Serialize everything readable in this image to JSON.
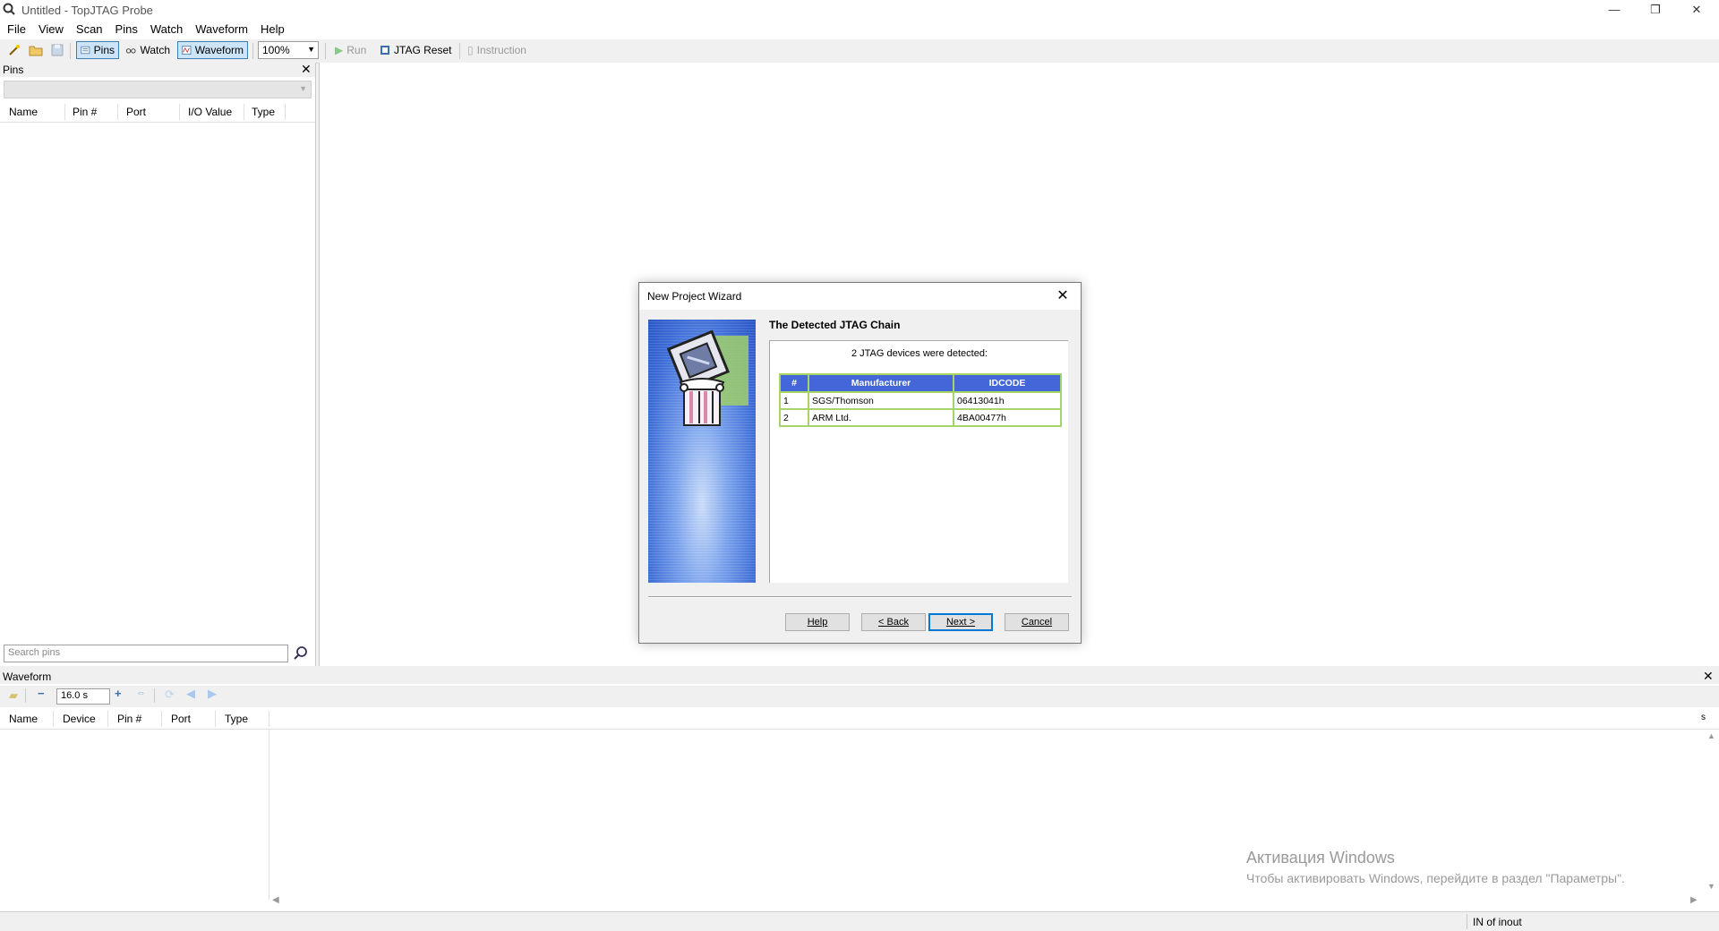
{
  "window": {
    "title": "Untitled - TopJTAG Probe",
    "minimize": "—",
    "maximize": "❐",
    "close": "✕"
  },
  "menu": [
    "File",
    "View",
    "Scan",
    "Pins",
    "Watch",
    "Waveform",
    "Help"
  ],
  "toolbar": {
    "pins_label": "Pins",
    "watch_label": "Watch",
    "waveform_label": "Waveform",
    "zoom_value": "100%",
    "run_label": "Run",
    "jtag_reset_label": "JTAG Reset",
    "instruction_label": "Instruction"
  },
  "pins_panel": {
    "title": "Pins",
    "columns": [
      "Name",
      "Pin #",
      "Port",
      "I/O Value",
      "Type"
    ],
    "search_placeholder": "Search pins"
  },
  "waveform_panel": {
    "title": "Waveform",
    "zoom_value": "16.0 s",
    "columns": [
      "Name",
      "Device",
      "Pin #",
      "Port",
      "Type"
    ],
    "time_unit": "s"
  },
  "statusbar": {
    "text": "IN of inout"
  },
  "watermark": {
    "line1": "Активация Windows",
    "line2": "Чтобы активировать Windows, перейдите в раздел \"Параметры\"."
  },
  "dialog": {
    "title": "New Project Wizard",
    "heading": "The Detected JTAG Chain",
    "subtitle": "2 JTAG devices were detected:",
    "table": {
      "headers": [
        "#",
        "Manufacturer",
        "IDCODE"
      ],
      "rows": [
        [
          "1",
          "SGS/Thomson",
          "06413041h"
        ],
        [
          "2",
          "ARM Ltd.",
          "4BA00477h"
        ]
      ]
    },
    "buttons": {
      "help": "Help",
      "back": "< Back",
      "next": "Next >",
      "cancel": "Cancel"
    }
  }
}
